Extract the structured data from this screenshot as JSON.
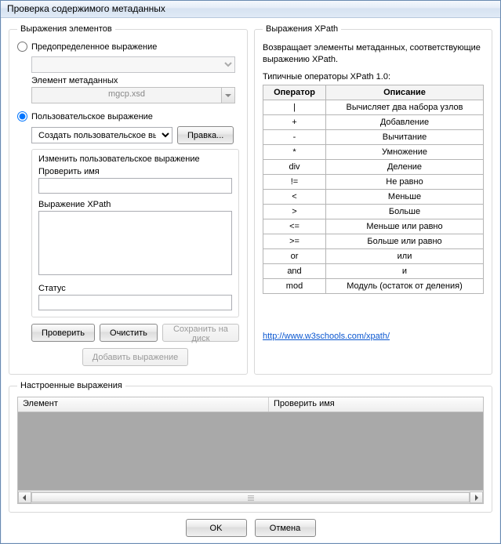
{
  "window": {
    "title": "Проверка содержимого метаданных"
  },
  "left": {
    "legend": "Выражения элементов",
    "radio_predef": "Предопределенное выражение",
    "meta_label": "Элемент метаданных",
    "meta_value": "mgcp.xsd",
    "radio_custom": "Пользовательское выражение",
    "custom_select": "Создать пользовательское выражение",
    "edit_btn": "Правка...",
    "edit_group_title": "Изменить пользовательское выражение",
    "check_name_label": "Проверить имя",
    "xpath_label": "Выражение XPath",
    "status_label": "Статус",
    "btn_check": "Проверить",
    "btn_clear": "Очистить",
    "btn_save": "Сохранить на диск",
    "btn_add": "Добавить выражение"
  },
  "right": {
    "legend": "Выражения XPath",
    "desc": "Возвращает элементы метаданных, соответствующие выражению XPath.",
    "sub": "Типичные операторы XPath 1.0:",
    "th_op": "Оператор",
    "th_desc": "Описание",
    "rows": [
      {
        "op": "|",
        "desc": "Вычисляет два набора узлов"
      },
      {
        "op": "+",
        "desc": "Добавление"
      },
      {
        "op": "-",
        "desc": "Вычитание"
      },
      {
        "op": "*",
        "desc": "Умножение"
      },
      {
        "op": "div",
        "desc": "Деление"
      },
      {
        "op": "!=",
        "desc": "Не равно"
      },
      {
        "op": "<",
        "desc": "Меньше"
      },
      {
        "op": ">",
        "desc": "Больше"
      },
      {
        "op": "<=",
        "desc": "Меньше или равно"
      },
      {
        "op": ">=",
        "desc": "Больше или равно"
      },
      {
        "op": "or",
        "desc": "или"
      },
      {
        "op": "and",
        "desc": "и"
      },
      {
        "op": "mod",
        "desc": "Модуль (остаток от деления)"
      }
    ],
    "link": "http://www.w3schools.com/xpath/"
  },
  "configured": {
    "legend": "Настроенные выражения",
    "col_element": "Элемент",
    "col_checkname": "Проверить имя"
  },
  "dialog": {
    "ok": "OK",
    "cancel": "Отмена"
  }
}
